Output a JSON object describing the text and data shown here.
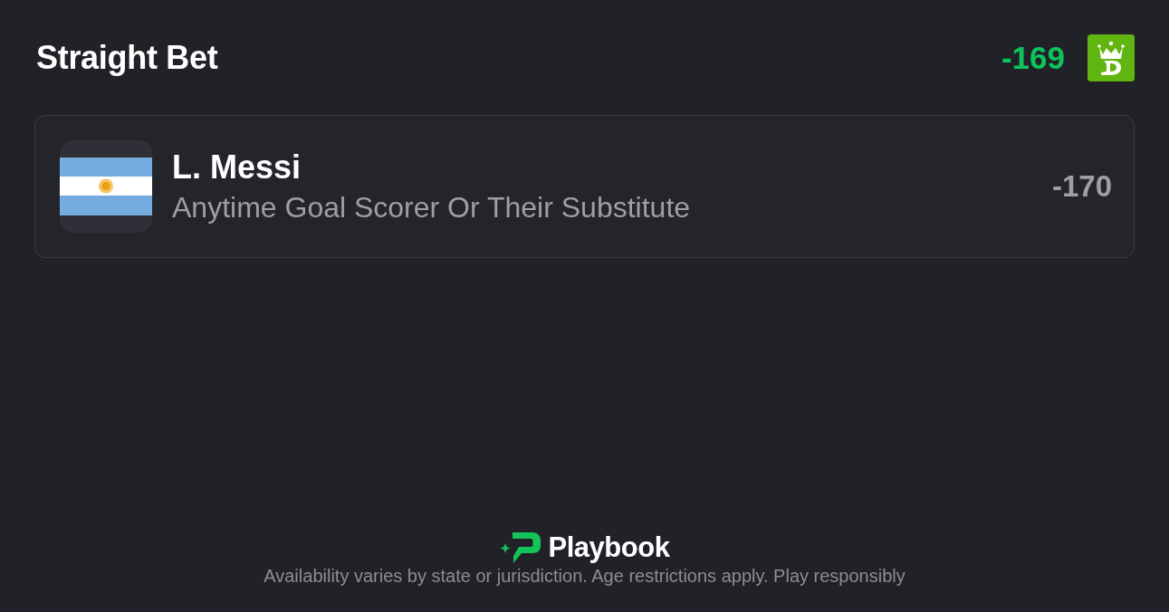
{
  "header": {
    "title": "Straight Bet",
    "odds": "-169"
  },
  "legs": [
    {
      "player": "L. Messi",
      "market": "Anytime Goal Scorer Or Their Substitute",
      "odds": "-170"
    }
  ],
  "footer": {
    "brand": "Playbook",
    "disclaimer": "Availability varies by state or jurisdiction. Age restrictions apply. Play responsibly"
  }
}
